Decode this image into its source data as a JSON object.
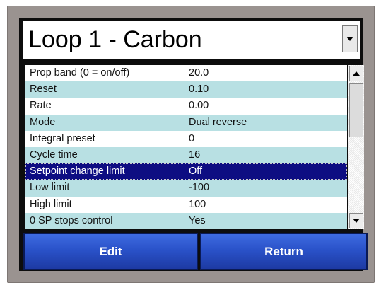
{
  "title": "Loop 1 - Carbon",
  "icons": {
    "dropdown": "chevron-down-icon",
    "scroll_up": "arrow-up-icon",
    "scroll_down": "arrow-down-icon"
  },
  "rows": [
    {
      "label": "Prop band (0 = on/off)",
      "value": "20.0"
    },
    {
      "label": "Reset",
      "value": "0.10"
    },
    {
      "label": "Rate",
      "value": "0.00"
    },
    {
      "label": "Mode",
      "value": "Dual reverse"
    },
    {
      "label": "Integral preset",
      "value": "0"
    },
    {
      "label": "Cycle time",
      "value": "16"
    },
    {
      "label": "Setpoint change limit",
      "value": "Off",
      "selected": true
    },
    {
      "label": "Low limit",
      "value": "-100"
    },
    {
      "label": "High limit",
      "value": "100"
    },
    {
      "label": "0 SP stops control",
      "value": "Yes"
    }
  ],
  "buttons": {
    "edit": "Edit",
    "return": "Return"
  },
  "colors": {
    "row_alt": "#b8e0e3",
    "row_selected": "#0d0d82",
    "button": "#2a52c9"
  }
}
